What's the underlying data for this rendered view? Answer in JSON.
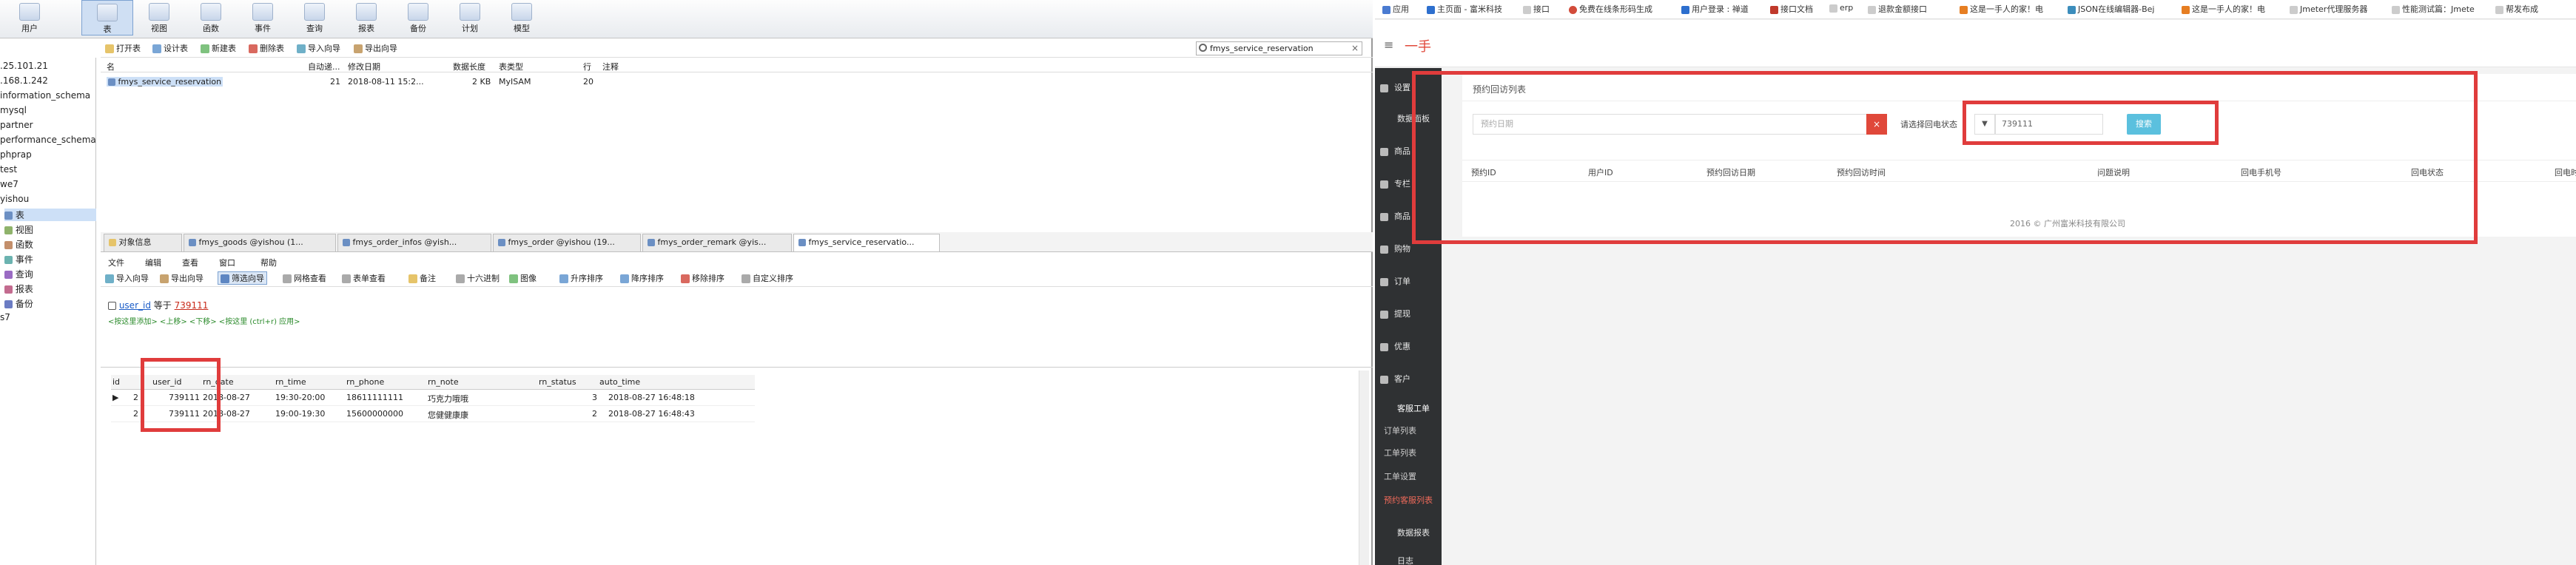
{
  "navicat": {
    "toolbar": [
      {
        "label": "用户",
        "icon": "user-icon"
      },
      {
        "label": "表",
        "icon": "table-icon"
      },
      {
        "label": "视图",
        "icon": "view-icon"
      },
      {
        "label": "函数",
        "icon": "function-icon"
      },
      {
        "label": "事件",
        "icon": "event-icon"
      },
      {
        "label": "查询",
        "icon": "query-icon"
      },
      {
        "label": "报表",
        "icon": "report-icon"
      },
      {
        "label": "备份",
        "icon": "backup-icon"
      },
      {
        "label": "计划",
        "icon": "schedule-icon"
      },
      {
        "label": "模型",
        "icon": "model-icon"
      }
    ],
    "tree": [
      ".25.101.21",
      ".168.1.242",
      "information_schema",
      "mysql",
      "partner",
      "performance_schema",
      "phprap",
      "test",
      "we7",
      "yishou",
      "表",
      "视图",
      "函数",
      "事件",
      "查询",
      "报表",
      "备份",
      "s7"
    ],
    "obj_toolbar": {
      "open": "打开表",
      "design": "设计表",
      "new": "新建表",
      "delete": "删除表",
      "import": "导入向导",
      "export": "导出向导",
      "search_value": "fmys_service_reservation"
    },
    "table_list": {
      "headers": [
        "名",
        "自动递...",
        "修改日期",
        "数据长度",
        "表类型",
        "行",
        "注释"
      ],
      "row": [
        "fmys_service_reservation",
        "21",
        "2018-08-11 15:2...",
        "2 KB",
        "MyISAM",
        "20",
        ""
      ]
    },
    "tabs": [
      "对象信息",
      "fmys_goods @yishou (1...",
      "fmys_order_infos @yish...",
      "fmys_order @yishou (19...",
      "fmys_order_remark @yis...",
      "fmys_service_reservatio..."
    ],
    "menu": [
      "文件",
      "编辑",
      "查看",
      "窗口",
      "帮助"
    ],
    "data_toolbar": [
      "导入向导",
      "导出向导",
      "筛选向导",
      "网格查看",
      "表单查看",
      "备注",
      "十六进制",
      "图像",
      "升序排序",
      "降序排序",
      "移除排序",
      "自定义排序"
    ],
    "filter": {
      "field": "user_id",
      "op": "等于",
      "value": "739111",
      "hint": "<按这里添加> <上移> <下移> <按这里 (ctrl+r) 应用>"
    },
    "grid": {
      "headers": [
        "id",
        "user_id",
        "rn_date",
        "rn_time",
        "rn_phone",
        "rn_note",
        "rn_status",
        "auto_time"
      ],
      "rows": [
        [
          "2",
          "739111",
          "2018-08-27",
          "19:30-20:00",
          "18611111111",
          "巧克力哦哦",
          "3",
          "2018-08-27 16:48:18"
        ],
        [
          "2",
          "739111",
          "2018-08-27",
          "19:00-19:30",
          "15600000000",
          "您健健康康",
          "2",
          "2018-08-27 16:48:43"
        ]
      ]
    }
  },
  "browser": {
    "bookmarks": [
      "应用",
      "主页面 - 富米科技",
      "接口",
      "免费在线条形码生成",
      "用户登录 : 禅道",
      "接口文档",
      "erp",
      "退款金额接口",
      "这是一手人的家！电",
      "JSON在线编辑器-Bej",
      "这是一手人的家！电",
      "Jmeter代理服务器",
      "性能测试篇：Jmete",
      "帮发布成"
    ]
  },
  "admin": {
    "logo": "一手",
    "nav": [
      {
        "label": "设置",
        "icon": "gear-icon"
      },
      {
        "label": "数据面板",
        "icon": ""
      },
      {
        "label": "商品",
        "icon": "tag-icon"
      },
      {
        "label": "专栏",
        "icon": "list-icon"
      },
      {
        "label": "商品",
        "icon": "cart-icon"
      },
      {
        "label": "购物",
        "icon": "bag-icon"
      },
      {
        "label": "订单",
        "icon": "order-icon"
      },
      {
        "label": "提现",
        "icon": "money-icon"
      },
      {
        "label": "优惠",
        "icon": "coupon-icon"
      },
      {
        "label": "客户",
        "icon": "user-icon"
      }
    ],
    "subnav": [
      "客服工单",
      "订单列表",
      "工单列表",
      "工单设置",
      "预约客服列表"
    ],
    "nav_bottom": [
      "数据报表",
      "日志"
    ],
    "panel_title": "预约回访列表",
    "date_placeholder": "预约日期",
    "status_label": "请选择回电状态",
    "search_value": "739111",
    "search_button": "搜索",
    "table_headers": [
      "预约ID",
      "用户ID",
      "预约回访日期",
      "预约回访时间",
      "问题说明",
      "回电手机号",
      "回电状态",
      "回电时间"
    ],
    "footer": "2016 © 广州富米科技有限公司"
  }
}
